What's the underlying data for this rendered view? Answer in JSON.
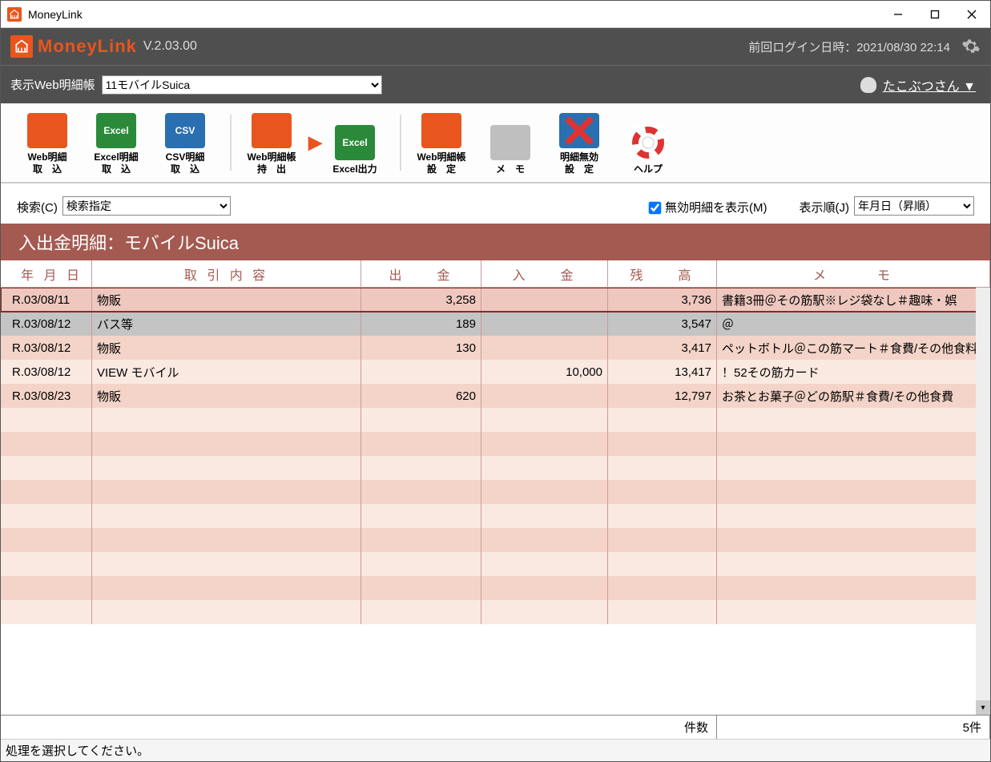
{
  "title_window": "MoneyLink",
  "logo_text": "MoneyLink",
  "version": "V.2.03.00",
  "last_login_label": "前回ログイン日時：2021/08/30 22:14",
  "ledger_label": "表示Web明細帳",
  "ledger_value": "11モバイルSuica",
  "user_name": "たこぶつさん ▼",
  "toolbar": {
    "web_import": "Web明細\n取　込",
    "excel_import": "Excel明細\n取　込",
    "csv_import": "CSV明細\n取　込",
    "web_export": "Web明細帳\n持　出",
    "excel_output": "Excel出力",
    "web_settings": "Web明細帳\n設　定",
    "memo": "メ　モ",
    "disable_settings": "明細無効\n設　定",
    "help": "ヘルプ"
  },
  "search_label": "検索(C)",
  "search_value": "検索指定",
  "show_disabled_label": "無効明細を表示(M)",
  "sort_label": "表示順(J)",
  "sort_value": "年月日（昇順）",
  "table_title": "入出金明細：モバイルSuica",
  "columns": {
    "date": "年 月 日",
    "desc": "取 引 内 容",
    "out": "出　　金",
    "in": "入　　金",
    "bal": "残　　高",
    "memo": "メ　　　モ"
  },
  "rows": [
    {
      "date": "R.03/08/11",
      "desc": "物販",
      "out": "3,258",
      "in": "",
      "bal": "3,736",
      "memo": "書籍3冊＠その筋駅※レジ袋なし＃趣味・娯",
      "state": "sel"
    },
    {
      "date": "R.03/08/12",
      "desc": "バス等",
      "out": "189",
      "in": "",
      "bal": "3,547",
      "memo": "＠",
      "state": "dis"
    },
    {
      "date": "R.03/08/12",
      "desc": "物販",
      "out": "130",
      "in": "",
      "bal": "3,417",
      "memo": "ペットボトル＠この筋マート＃食費/その他食料",
      "state": "even"
    },
    {
      "date": "R.03/08/12",
      "desc": "VIEW モバイル",
      "out": "",
      "in": "10,000",
      "bal": "13,417",
      "memo": "！52その筋カード",
      "state": "odd"
    },
    {
      "date": "R.03/08/23",
      "desc": "物販",
      "out": "620",
      "in": "",
      "bal": "12,797",
      "memo": "お茶とお菓子＠どの筋駅＃食費/その他食費",
      "state": "even"
    }
  ],
  "count_label": "件数",
  "count_value": "5件",
  "status_text": "処理を選択してください。"
}
